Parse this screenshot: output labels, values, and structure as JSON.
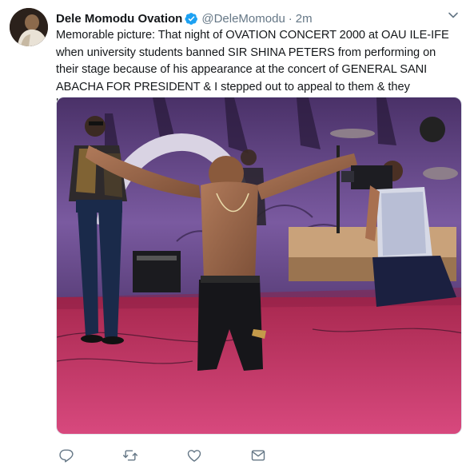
{
  "tweet": {
    "display_name": "Dele Momodu Ovation",
    "handle": "@DeleMomodu",
    "separator": "·",
    "time": "2m",
    "text": "Memorable picture: That night of OVATION CONCERT 2000 at OAU ILE-IFE when university students banned SIR SHINA PETERS from performing on their stage because of his appearance at the concert of GENERAL SANI ABACHA FOR PRESIDENT & I stepped out to appeal to them & they honoured me!"
  },
  "media": {
    "description_icon": "photo"
  },
  "actions": [
    {
      "icon": "reply-icon"
    },
    {
      "icon": "retweet-icon"
    },
    {
      "icon": "like-icon"
    },
    {
      "icon": "direct-message-icon"
    }
  ],
  "colors": {
    "verified": "#1da1f2",
    "meta_text": "#657786",
    "icon": "#657786",
    "stage_floor": "#c93a6e",
    "backdrop": "#6a4b8d"
  }
}
